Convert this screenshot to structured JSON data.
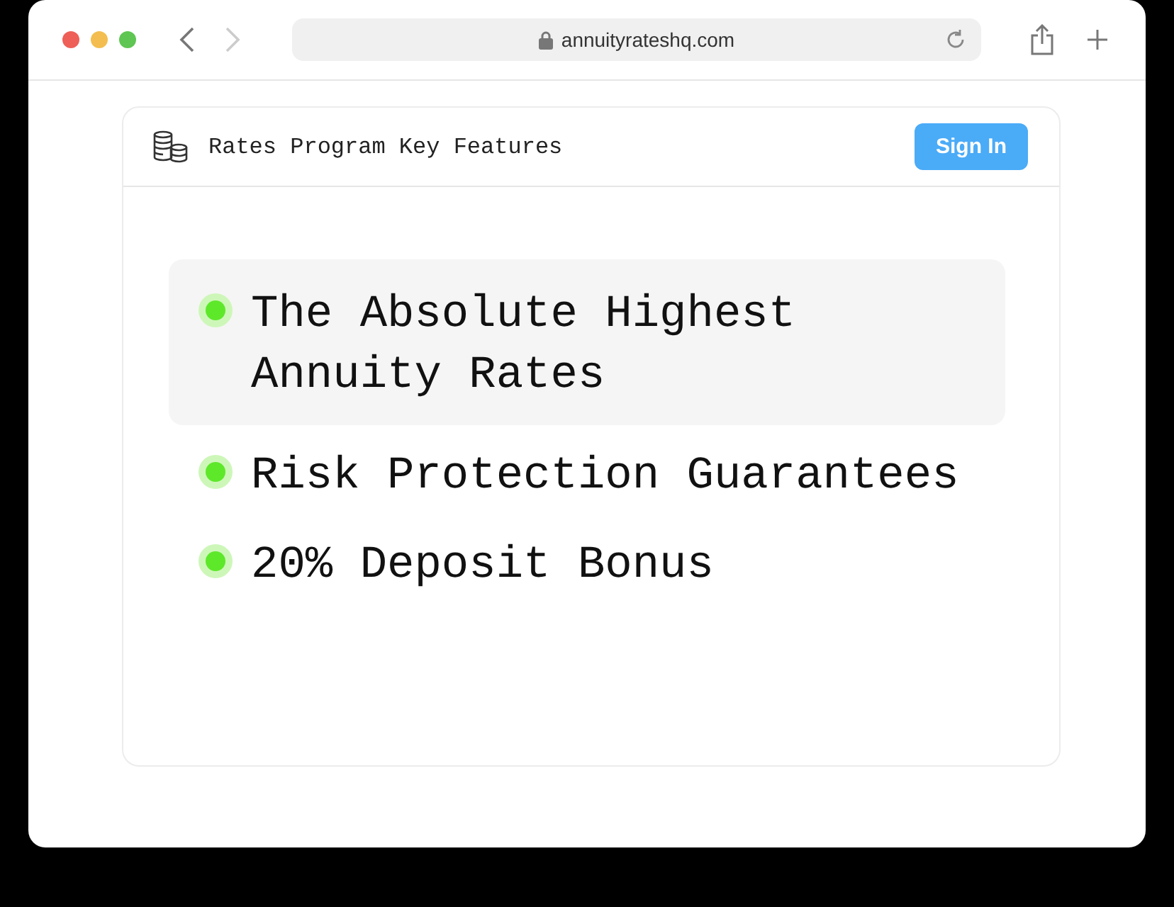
{
  "browser": {
    "url": "annuityrateshq.com"
  },
  "header": {
    "title": "Rates Program Key Features",
    "button": "Sign In"
  },
  "features": [
    {
      "text": "The Absolute Highest Annuity Rates",
      "selected": true
    },
    {
      "text": "Risk Protection Guarantees",
      "selected": false
    },
    {
      "text": "20% Deposit Bonus",
      "selected": false
    }
  ]
}
